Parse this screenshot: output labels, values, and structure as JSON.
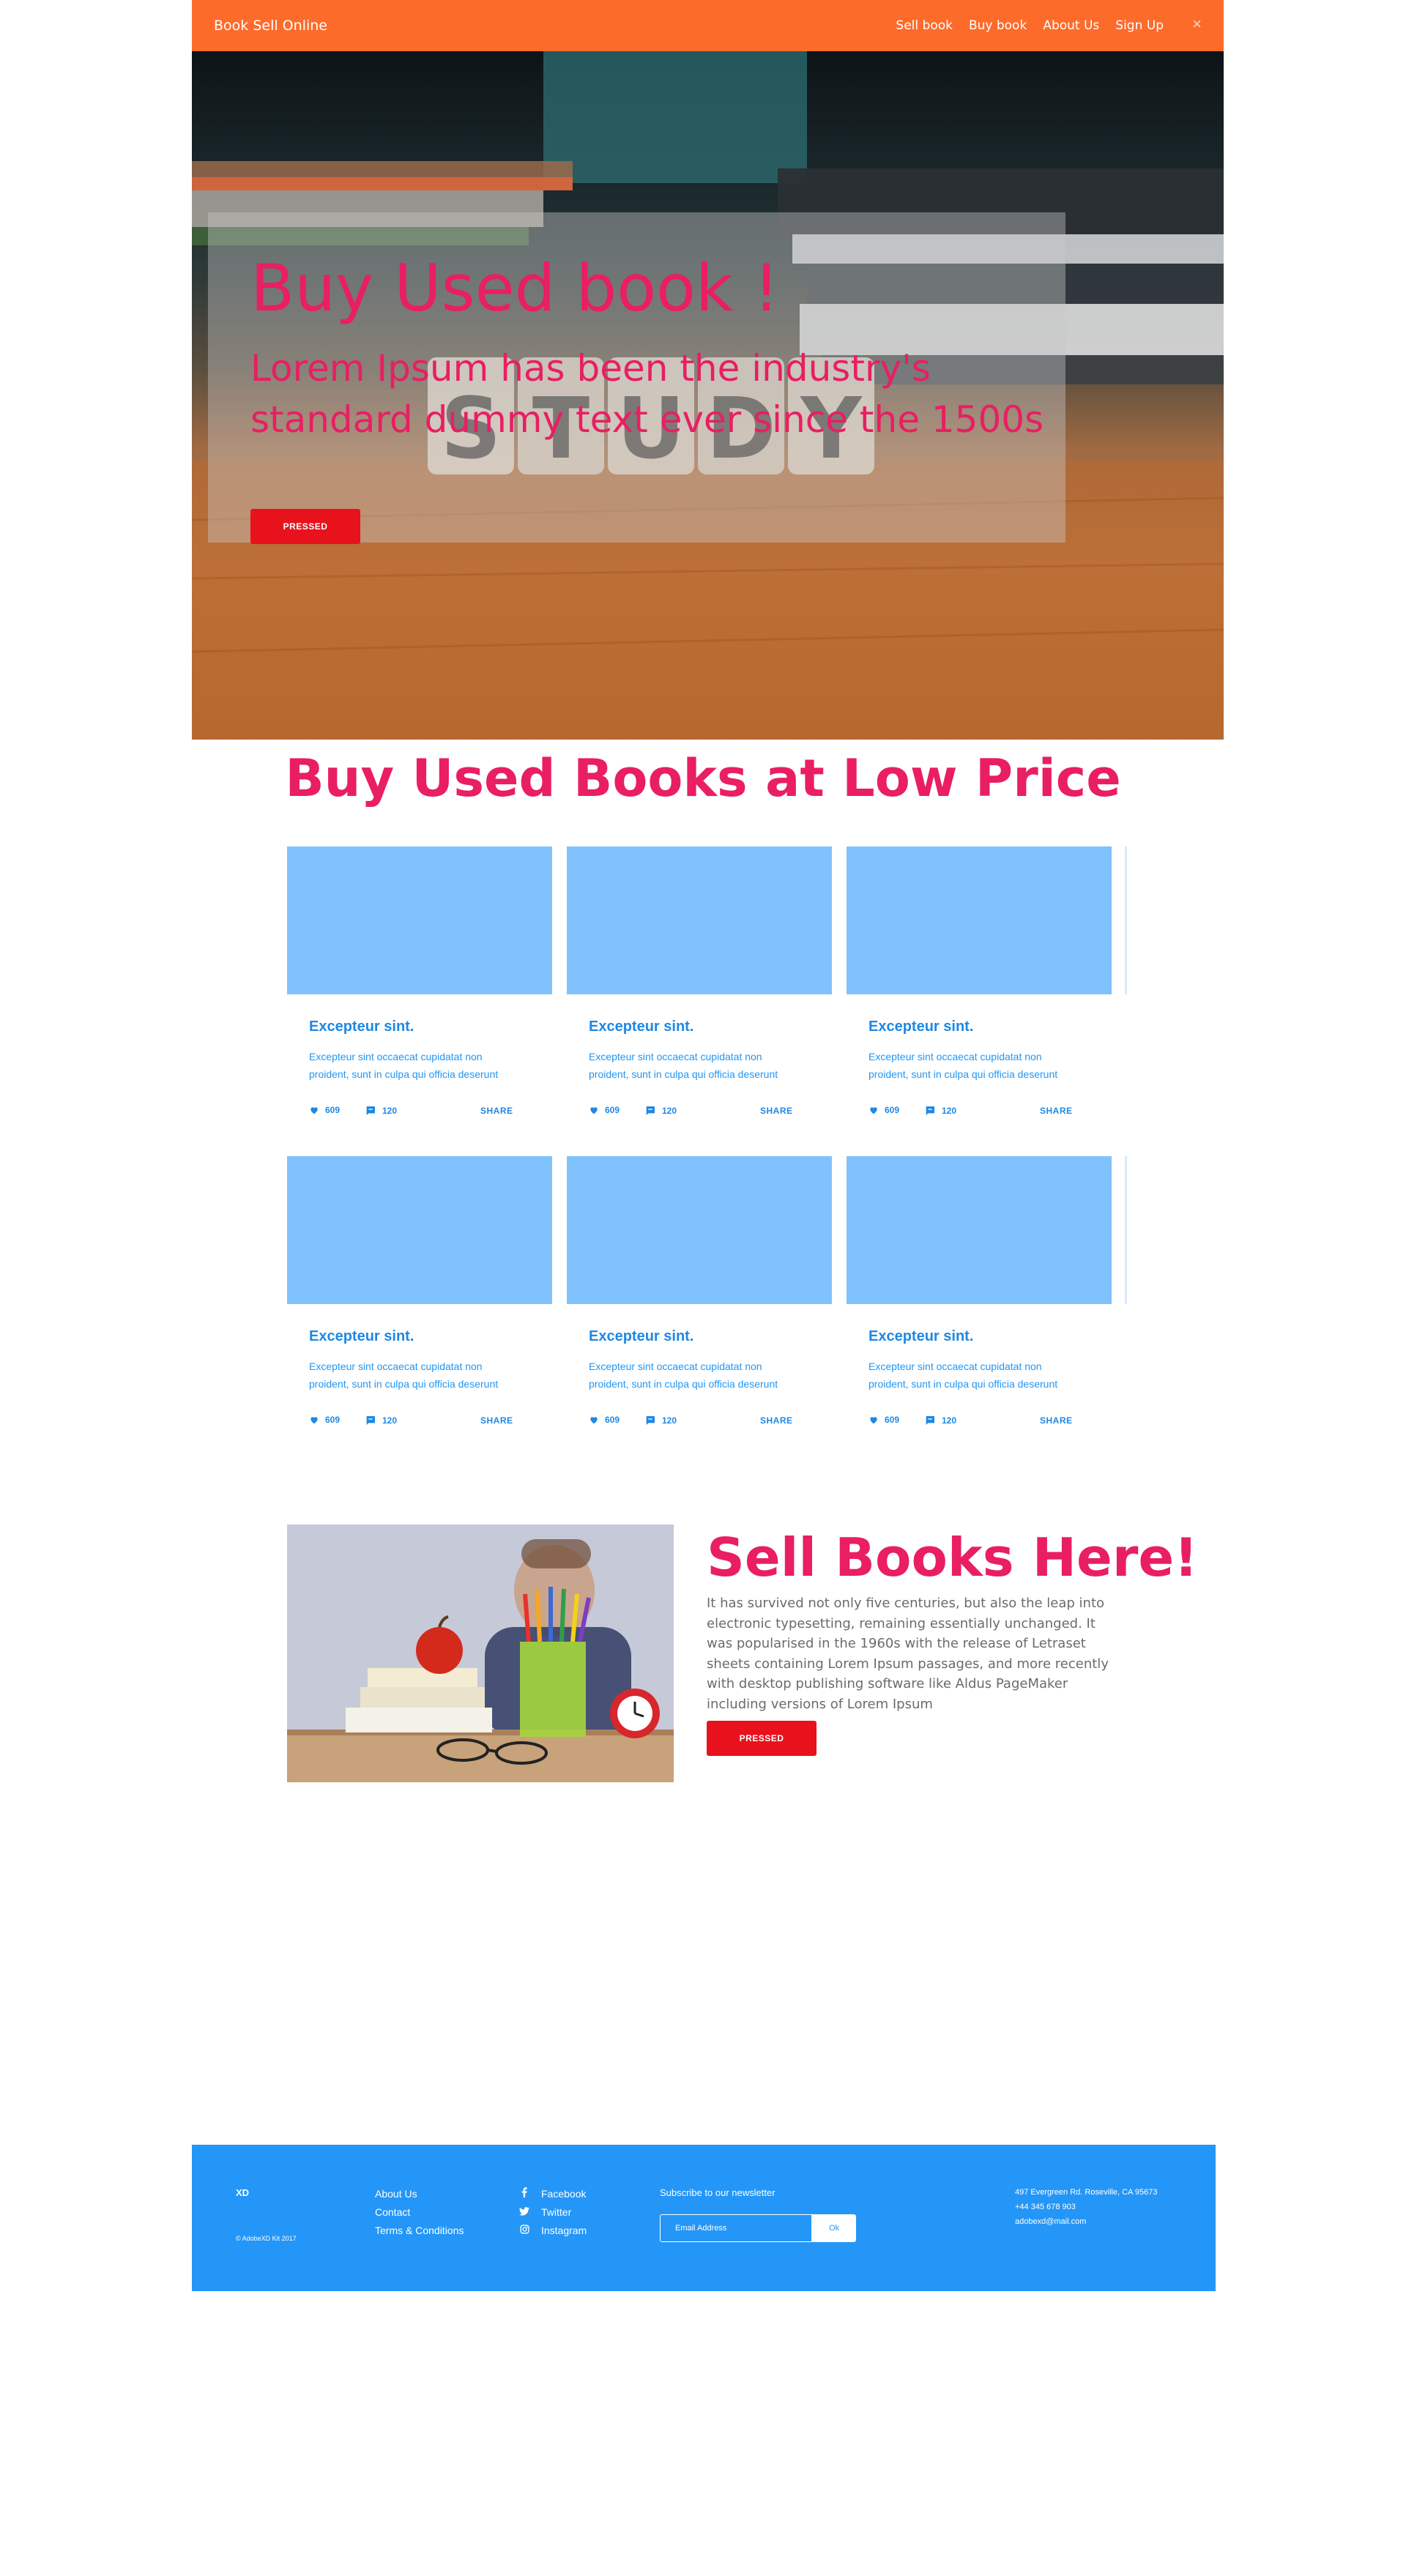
{
  "navbar": {
    "brand": "Book Sell Online",
    "links": [
      "Sell book",
      "Buy book",
      "About Us",
      "Sign Up"
    ],
    "close_glyph": "×"
  },
  "hero": {
    "title": "Buy Used book !",
    "subtitle": "Lorem Ipsum has been the industry's standard dummy text ever since the 1500s",
    "button_label": "PRESSED"
  },
  "books_section": {
    "title": "Buy Used Books at Low Price",
    "cards": [
      {
        "title": "Excepteur sint.",
        "text": "Excepteur sint occaecat cupidatat non proident, sunt in culpa qui officia deserunt",
        "likes": "609",
        "comments": "120",
        "share": "SHARE"
      },
      {
        "title": "Excepteur sint.",
        "text": "Excepteur sint occaecat cupidatat non proident, sunt in culpa qui officia deserunt",
        "likes": "609",
        "comments": "120",
        "share": "SHARE"
      },
      {
        "title": "Excepteur sint.",
        "text": "Excepteur sint occaecat cupidatat non proident, sunt in culpa qui officia deserunt",
        "likes": "609",
        "comments": "120",
        "share": "SHARE"
      },
      {
        "title": "Excepteur sint.",
        "text": "Excepteur sint occaecat cupidatat non proident, sunt in culpa qui officia deserunt",
        "likes": "609",
        "comments": "120",
        "share": "SHARE"
      },
      {
        "title": "Excepteur sint.",
        "text": "Excepteur sint occaecat cupidatat non proident, sunt in culpa qui officia deserunt",
        "likes": "609",
        "comments": "120",
        "share": "SHARE"
      },
      {
        "title": "Excepteur sint.",
        "text": "Excepteur sint occaecat cupidatat non proident, sunt in culpa qui officia deserunt",
        "likes": "609",
        "comments": "120",
        "share": "SHARE"
      }
    ]
  },
  "sell_section": {
    "title": "Sell Books Here!",
    "text": "It has survived not only five centuries, but also the leap into electronic typesetting, remaining essentially unchanged. It was popularised in the 1960s with the release of Letraset sheets containing Lorem Ipsum passages, and more recently with desktop publishing software like Aldus PageMaker including versions of Lorem Ipsum",
    "button_label": "PRESSED"
  },
  "footer": {
    "logo": "XD",
    "copyright": "© AdobeXD Kit 2017",
    "links": [
      "About Us",
      "Contact",
      "Terms & Conditions"
    ],
    "social": [
      {
        "icon": "facebook-icon",
        "label": "Facebook"
      },
      {
        "icon": "twitter-icon",
        "label": "Twitter"
      },
      {
        "icon": "instagram-icon",
        "label": "Instagram"
      }
    ],
    "newsletter_label": "Subscribe to our newsletter",
    "email_placeholder": "Email Address",
    "ok_label": "Ok",
    "address_lines": [
      "497 Evergreen Rd. Roseville, CA 95673",
      "+44 345 678 903",
      "adobexd@mail.com"
    ]
  },
  "colors": {
    "navbar": "#fd6b2b",
    "accent_pink": "#e91e63",
    "button_red": "#e8121d",
    "card_image_blue": "#80c2fd",
    "link_blue": "#1e88e5",
    "footer_blue": "#2496f8"
  }
}
